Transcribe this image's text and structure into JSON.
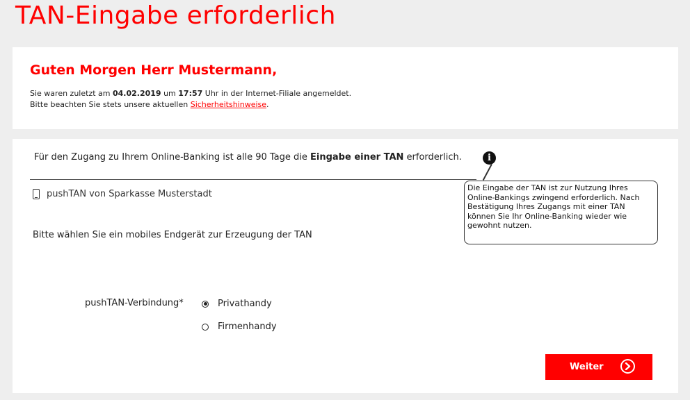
{
  "page": {
    "title": "TAN-Eingabe erforderlich"
  },
  "greeting": {
    "title": "Guten Morgen Herr Mustermann,",
    "last_login_prefix": "Sie waren zuletzt am ",
    "last_login_date": "04.02.2019",
    "last_login_mid": " um ",
    "last_login_time": "17:57",
    "last_login_suffix": " Uhr in der Internet-Filiale angemeldet.",
    "security_prefix": "Bitte beachten Sie stets unsere aktuellen ",
    "security_link": "Sicherheitshinweise",
    "security_suffix": "."
  },
  "main": {
    "intro_prefix": "Für den Zugang zu Ihrem Online-Banking ist alle 90 Tage die ",
    "intro_bold": "Eingabe einer TAN",
    "intro_suffix": " erforderlich.",
    "tooltip_text": "Die Eingabe der TAN ist zur Nutzung Ihres Online-Bankings zwingend erforderlich. Nach Bestätigung Ihres Zugangs mit einer TAN können Sie Ihr Online-Banking wieder wie gewohnt nutzen.",
    "pushtan_label": "pushTAN von Sparkasse Musterstadt",
    "select_device_text": "Bitte wählen Sie ein mobiles Endgerät zur Erzeugung der TAN",
    "connection_label": "pushTAN-Verbindung*",
    "options": [
      {
        "label": "Privathandy",
        "selected": true
      },
      {
        "label": "Firmenhandy",
        "selected": false
      }
    ],
    "submit_label": "Weiter"
  },
  "icons": {
    "info": "info-icon",
    "phone": "phone-icon",
    "arrow": "chevron-right-circle-icon"
  },
  "colors": {
    "accent": "#ff0000",
    "background": "#eeeeee"
  }
}
